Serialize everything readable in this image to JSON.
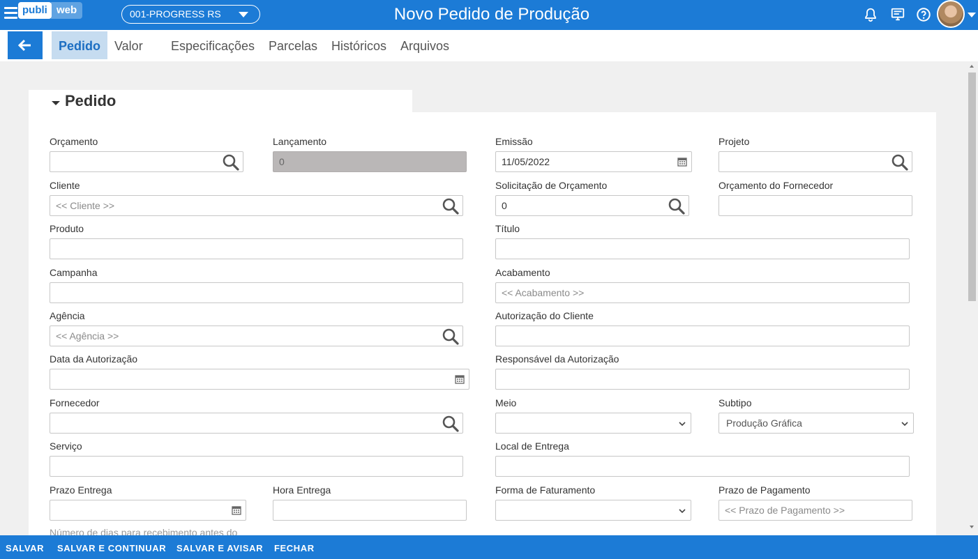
{
  "header": {
    "logo_left": "publi",
    "logo_right": "web",
    "company": "001-PROGRESS RS",
    "title": "Novo Pedido de Produção"
  },
  "tabs": [
    {
      "label": "Pedido",
      "active": true
    },
    {
      "label": "Valor"
    },
    {
      "label": "Especificações"
    },
    {
      "label": "Parcelas"
    },
    {
      "label": "Históricos"
    },
    {
      "label": "Arquivos"
    }
  ],
  "section": {
    "title": "Pedido"
  },
  "form": {
    "orcamento": {
      "label": "Orçamento",
      "value": ""
    },
    "lancamento": {
      "label": "Lançamento",
      "value": "0"
    },
    "emissao": {
      "label": "Emissão",
      "value": "11/05/2022"
    },
    "projeto": {
      "label": "Projeto",
      "value": ""
    },
    "cliente": {
      "label": "Cliente",
      "placeholder": "<< Cliente >>"
    },
    "solicitacao": {
      "label": "Solicitação de Orçamento",
      "value": "0"
    },
    "orc_fornecedor": {
      "label": "Orçamento do Fornecedor",
      "value": ""
    },
    "produto": {
      "label": "Produto",
      "value": ""
    },
    "titulo": {
      "label": "Título",
      "value": ""
    },
    "campanha": {
      "label": "Campanha",
      "value": ""
    },
    "acabamento": {
      "label": "Acabamento",
      "placeholder": "<< Acabamento >>"
    },
    "agencia": {
      "label": "Agência",
      "placeholder": "<< Agência >>"
    },
    "autorizacao_cliente": {
      "label": "Autorização do Cliente",
      "value": ""
    },
    "data_autorizacao": {
      "label": "Data da Autorização",
      "value": ""
    },
    "responsavel_autorizacao": {
      "label": "Responsável da Autorização",
      "value": ""
    },
    "fornecedor": {
      "label": "Fornecedor",
      "value": ""
    },
    "meio": {
      "label": "Meio",
      "value": ""
    },
    "subtipo": {
      "label": "Subtipo",
      "value": "Produção Gráfica"
    },
    "servico": {
      "label": "Serviço",
      "value": ""
    },
    "local_entrega": {
      "label": "Local de Entrega",
      "value": ""
    },
    "prazo_entrega": {
      "label": "Prazo Entrega",
      "value": ""
    },
    "hora_entrega": {
      "label": "Hora Entrega",
      "value": ""
    },
    "forma_faturamento": {
      "label": "Forma de Faturamento",
      "value": ""
    },
    "prazo_pagamento": {
      "label": "Prazo de Pagamento",
      "placeholder": "<< Prazo de Pagamento >>"
    },
    "cut_hint": "Número de dias para recebimento antes do"
  },
  "footer": {
    "salvar": "SALVAR",
    "salvar_continuar": "SALVAR E CONTINUAR",
    "salvar_avisar": "SALVAR E AVISAR",
    "fechar": "FECHAR"
  },
  "colors": {
    "primary": "#1c7bd6",
    "active_tab_bg": "#c6dcf0"
  }
}
